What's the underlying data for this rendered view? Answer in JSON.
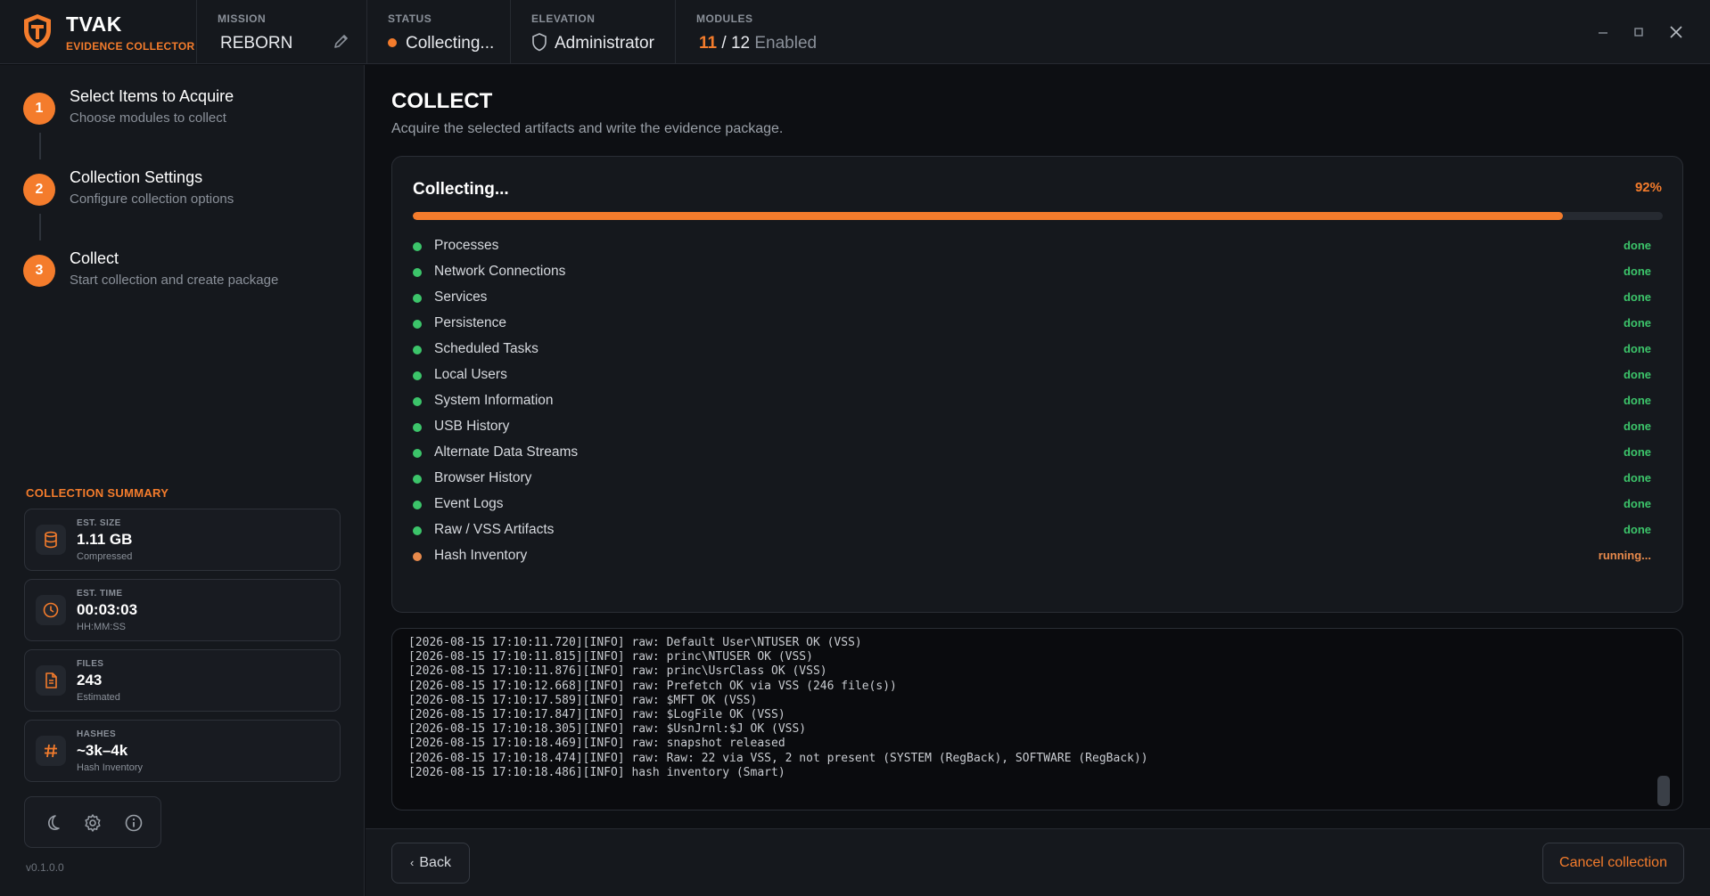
{
  "app": {
    "name": "TVAK",
    "subtitle": "EVIDENCE COLLECTOR",
    "version": "v0.1.0.0"
  },
  "header": {
    "mission": {
      "label": "MISSION",
      "value": "REBORN"
    },
    "status": {
      "label": "STATUS",
      "value": "Collecting..."
    },
    "elevation": {
      "label": "ELEVATION",
      "value": "Administrator"
    },
    "modules": {
      "label": "MODULES",
      "enabled": "11",
      "separator": "/",
      "total": "12",
      "suffix": "Enabled"
    }
  },
  "steps": [
    {
      "num": "1",
      "title": "Select Items to Acquire",
      "desc": "Choose modules to collect"
    },
    {
      "num": "2",
      "title": "Collection Settings",
      "desc": "Configure collection options"
    },
    {
      "num": "3",
      "title": "Collect",
      "desc": "Start collection and create package"
    }
  ],
  "summary": {
    "title": "COLLECTION SUMMARY",
    "cards": [
      {
        "key": "EST. SIZE",
        "value": "1.11 GB",
        "sub": "Compressed",
        "icon": "database-icon"
      },
      {
        "key": "EST. TIME",
        "value": "00:03:03",
        "sub": "HH:MM:SS",
        "icon": "clock-icon"
      },
      {
        "key": "FILES",
        "value": "243",
        "sub": "Estimated",
        "icon": "file-icon"
      },
      {
        "key": "HASHES",
        "value": "~3k–4k",
        "sub": "Hash Inventory",
        "icon": "hash-icon"
      }
    ]
  },
  "main": {
    "title": "COLLECT",
    "subtitle": "Acquire the selected artifacts and write the evidence package.",
    "progress": {
      "label": "Collecting...",
      "percent_text": "92%",
      "fraction": 0.92
    },
    "modules": [
      {
        "name": "Processes",
        "status": "done"
      },
      {
        "name": "Network Connections",
        "status": "done"
      },
      {
        "name": "Services",
        "status": "done"
      },
      {
        "name": "Persistence",
        "status": "done"
      },
      {
        "name": "Scheduled Tasks",
        "status": "done"
      },
      {
        "name": "Local Users",
        "status": "done"
      },
      {
        "name": "System Information",
        "status": "done"
      },
      {
        "name": "USB History",
        "status": "done"
      },
      {
        "name": "Alternate Data Streams",
        "status": "done"
      },
      {
        "name": "Browser History",
        "status": "done"
      },
      {
        "name": "Event Logs",
        "status": "done"
      },
      {
        "name": "Raw / VSS Artifacts",
        "status": "done"
      },
      {
        "name": "Hash Inventory",
        "status": "running..."
      }
    ],
    "log": [
      "[2026-08-15 17:10:11.720][INFO] raw: Default User\\NTUSER OK (VSS)",
      "[2026-08-15 17:10:11.815][INFO] raw: princ\\NTUSER OK (VSS)",
      "[2026-08-15 17:10:11.876][INFO] raw: princ\\UsrClass OK (VSS)",
      "[2026-08-15 17:10:12.668][INFO] raw: Prefetch OK via VSS (246 file(s))",
      "[2026-08-15 17:10:17.589][INFO] raw: $MFT OK (VSS)",
      "[2026-08-15 17:10:17.847][INFO] raw: $LogFile OK (VSS)",
      "[2026-08-15 17:10:18.305][INFO] raw: $UsnJrnl:$J OK (VSS)",
      "[2026-08-15 17:10:18.469][INFO] raw: snapshot released",
      "[2026-08-15 17:10:18.474][INFO] raw: Raw: 22 via VSS, 2 not present (SYSTEM (RegBack), SOFTWARE (RegBack))",
      "[2026-08-15 17:10:18.486][INFO] hash inventory (Smart)"
    ]
  },
  "footer": {
    "back_label": "Back",
    "cancel_label": "Cancel collection"
  },
  "colors": {
    "accent": "#f47c2c",
    "done": "#3cc46a",
    "running": "#e88a4c"
  }
}
